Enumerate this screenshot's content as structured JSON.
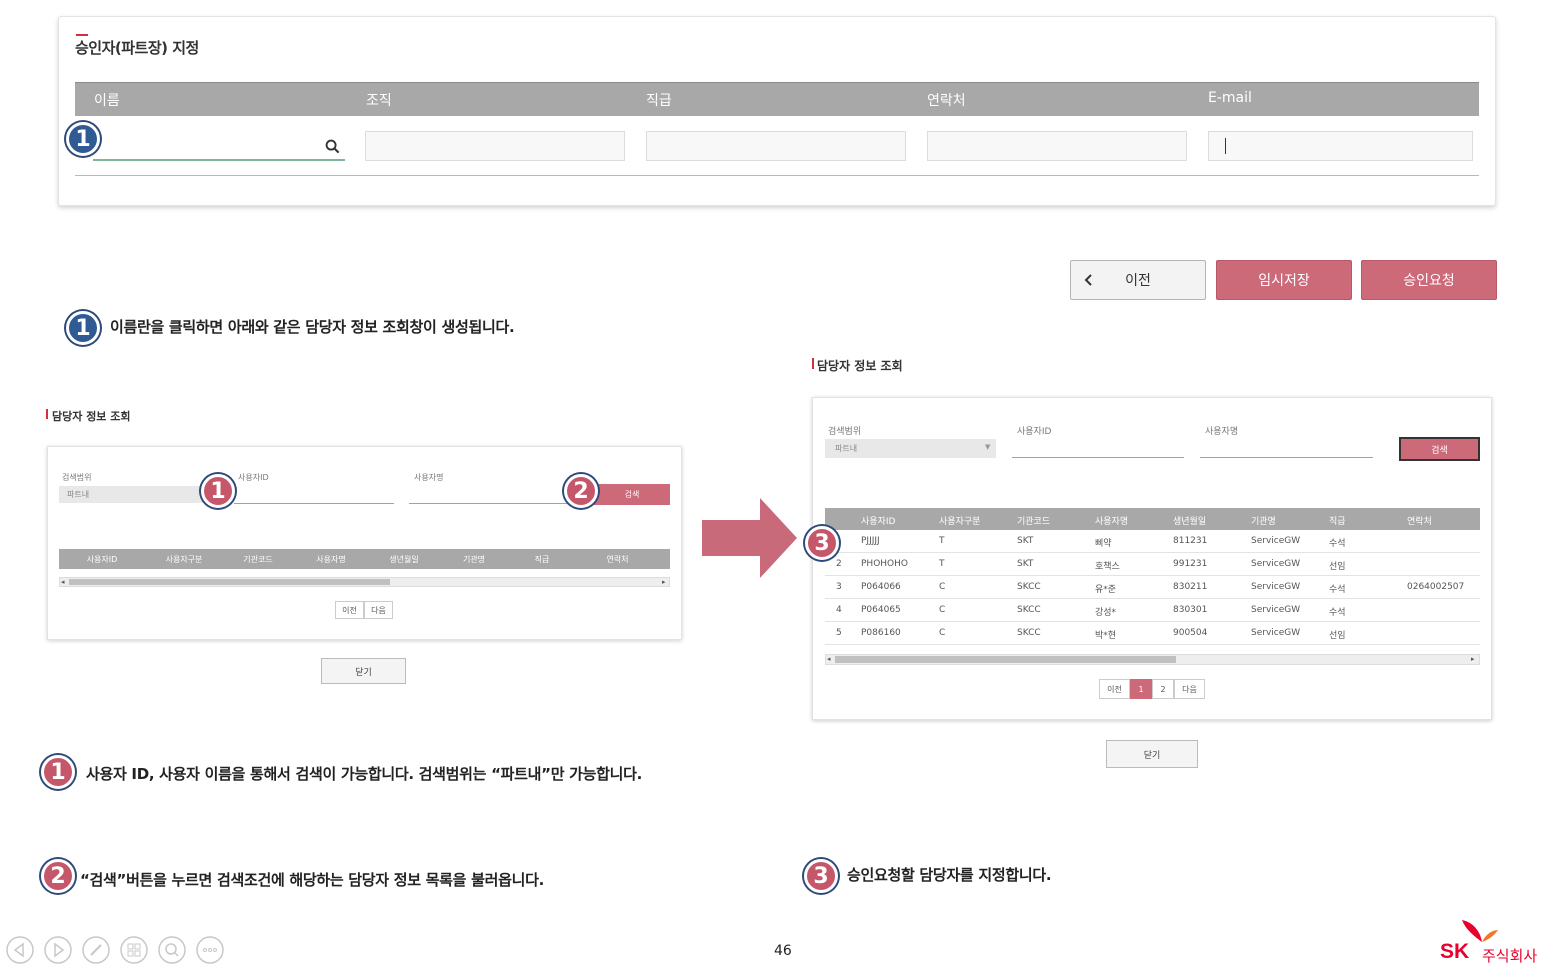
{
  "approver": {
    "title": "승인자(파트장) 지정",
    "columns": [
      "이름",
      "조직",
      "직급",
      "연락처",
      "E-mail"
    ]
  },
  "actions": {
    "prev_label": "이전",
    "temp_save_label": "임시저장",
    "approve_request_label": "승인요청"
  },
  "badges": {
    "one": "1",
    "two": "2",
    "three": "3"
  },
  "descriptions": {
    "step1_intro": "이름란을 클릭하면 아래와 같은 담당자 정보 조회창이 생성됩니다.",
    "step1": "사용자 ID, 사용자 이름을 통해서 검색이 가능합니다. 검색범위는 “파트내”만 가능합니다.",
    "step2": "“검색”버튼을 누르면 검색조건에 해당하는 담당자 정보 목록을 불러옵니다.",
    "step3": "승인요청할 담당자를 지정합니다."
  },
  "small_dialog": {
    "title": "담당자 정보 조회",
    "scope_label": "검색범위",
    "scope_value": "파트내",
    "user_id_label": "사용자ID",
    "user_name_label": "사용자명",
    "search_label": "검색",
    "columns": [
      "사용자ID",
      "사용자구분",
      "기관코드",
      "사용자명",
      "생년월일",
      "기관명",
      "직급",
      "연락처"
    ],
    "prev_label": "이전",
    "next_label": "다음",
    "close_label": "닫기"
  },
  "big_dialog": {
    "title": "담당자 정보 조회",
    "scope_label": "검색범위",
    "scope_value": "파트내",
    "user_id_label": "사용자ID",
    "user_name_label": "사용자명",
    "search_label": "검색",
    "columns": [
      "사용자ID",
      "사용자구분",
      "기관코드",
      "사용자명",
      "생년월일",
      "기관명",
      "직급",
      "연락처"
    ],
    "rows": [
      {
        "no": "",
        "id": "PJJJJJ",
        "type": "T",
        "org_code": "SKT",
        "name": "삐약",
        "birth": "811231",
        "org": "ServiceGW",
        "rank": "수석",
        "phone": ""
      },
      {
        "no": "2",
        "id": "PHOHOHO",
        "type": "T",
        "org_code": "SKT",
        "name": "호책스",
        "birth": "991231",
        "org": "ServiceGW",
        "rank": "선임",
        "phone": ""
      },
      {
        "no": "3",
        "id": "P064066",
        "type": "C",
        "org_code": "SKCC",
        "name": "유*준",
        "birth": "830211",
        "org": "ServiceGW",
        "rank": "수석",
        "phone": "0264002507"
      },
      {
        "no": "4",
        "id": "P064065",
        "type": "C",
        "org_code": "SKCC",
        "name": "강성*",
        "birth": "830301",
        "org": "ServiceGW",
        "rank": "수석",
        "phone": ""
      },
      {
        "no": "5",
        "id": "P086160",
        "type": "C",
        "org_code": "SKCC",
        "name": "박*현",
        "birth": "900504",
        "org": "ServiceGW",
        "rank": "선임",
        "phone": ""
      }
    ],
    "pager": {
      "prev": "이전",
      "pages": [
        "1",
        "2"
      ],
      "current": "1",
      "next": "다음"
    },
    "close_label": "닫기"
  },
  "footer": {
    "page_number": "46",
    "logo_mark": "SK",
    "logo_text": "주식회사"
  },
  "colors": {
    "accent_red": "#cc6a7a",
    "badge_blue": "#2f5a93",
    "header_gray": "#a8a8a8"
  }
}
